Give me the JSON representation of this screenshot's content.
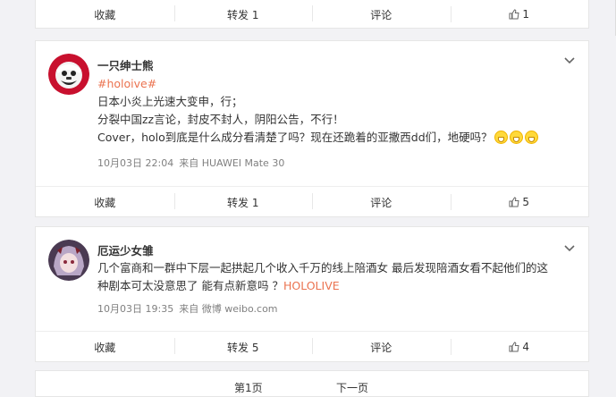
{
  "top_card": {
    "actions": {
      "favorite": "收藏",
      "repost": "转发 1",
      "comment": "评论",
      "like": "1"
    }
  },
  "posts": [
    {
      "username": "一只绅士熊",
      "tag": "#holoive#",
      "lines": [
        "日本小炎上光速大变申，行；",
        "分裂中国zz言论，封皮不封人，阴阳公告，不行！",
        "Cover，holo到底是什么成分看清楚了吗？现在还跪着的亚撒西dd们，地硬吗？"
      ],
      "emoji": "grin-emoji",
      "time": "10月03日 22:04",
      "source": "来自 HUAWEI Mate 30",
      "actions": {
        "favorite": "收藏",
        "repost": "转发 1",
        "comment": "评论",
        "like": "5"
      }
    },
    {
      "username": "厄运少女雏",
      "lines": [
        "几个富商和一群中下层一起拱起几个收入千万的线上陪酒女 最后发现陪酒女看不起他们的这",
        "种剧本可太没意思了 能有点新意吗 ？"
      ],
      "tag": "HOLOLIVE",
      "time": "10月03日 19:35",
      "source": "来自 微博 weibo.com",
      "actions": {
        "favorite": "收藏",
        "repost": "转发 5",
        "comment": "评论",
        "like": "4"
      }
    }
  ],
  "pagination": {
    "current": "第1页",
    "next": "下一页"
  },
  "colors": {
    "accent": "#eb7350",
    "meta": "#808080",
    "background": "#f2f2f5"
  }
}
